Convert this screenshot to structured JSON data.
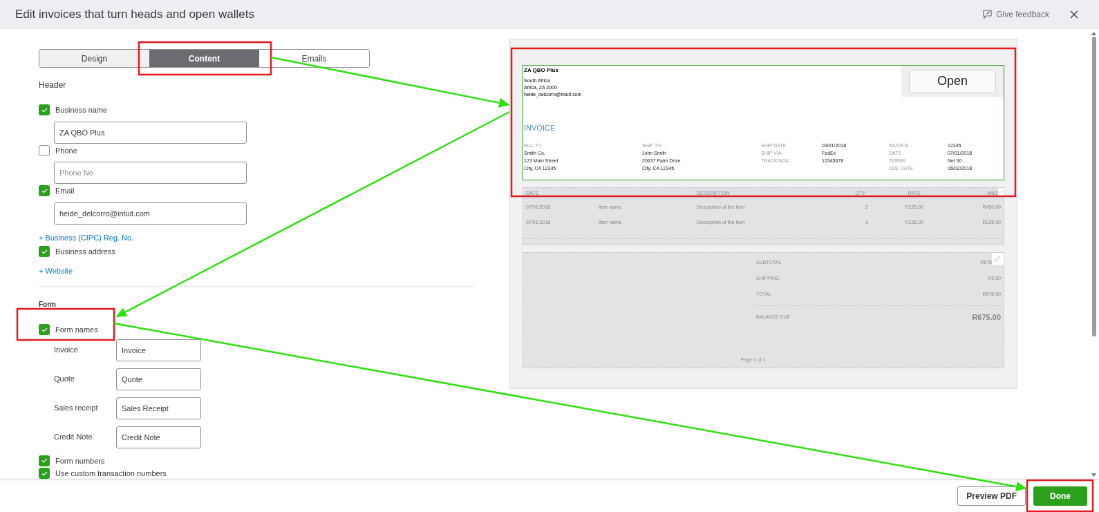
{
  "dialog": {
    "title": "Edit invoices that turn heads and open wallets",
    "feedback": "Give feedback"
  },
  "tabs": [
    {
      "label": "Design",
      "selected": false
    },
    {
      "label": "Content",
      "selected": true
    },
    {
      "label": "Emails",
      "selected": false
    }
  ],
  "header": {
    "title": "Header",
    "items": [
      {
        "kind": "check",
        "label": "Business name",
        "checked": true,
        "field": {
          "value": "ZA QBO Plus"
        }
      },
      {
        "kind": "check",
        "label": "Phone",
        "checked": false,
        "field": {
          "placeholder": "Phone No"
        }
      },
      {
        "kind": "check",
        "label": "Email",
        "checked": true,
        "field": {
          "value": "heide_delcorro@intuit.com"
        }
      },
      {
        "kind": "link",
        "label": "+ Business (CIPC) Reg. No."
      },
      {
        "kind": "check",
        "label": "Business address",
        "checked": true
      },
      {
        "kind": "link",
        "label": "+ Website"
      }
    ]
  },
  "form": {
    "title": "Form",
    "form_names": {
      "label": "Form names",
      "checked": true
    },
    "names": [
      {
        "label": "Invoice",
        "value": "Invoice"
      },
      {
        "label": "Quote",
        "value": "Quote"
      },
      {
        "label": "Sales receipt",
        "value": "Sales Receipt"
      },
      {
        "label": "Credit Note",
        "value": "Credit Note"
      }
    ],
    "more": [
      {
        "label": "Form numbers",
        "checked": true
      },
      {
        "label": "Use custom transaction numbers",
        "checked": true
      }
    ]
  },
  "preview": {
    "company": {
      "name": "ZA QBO Plus",
      "lines": [
        "South Africa",
        "Africa, ZA 2000",
        "heide_delcorro@intuit.com"
      ]
    },
    "open_button": "Open",
    "doc_title": "INVOICE",
    "bill_to": {
      "label": "BILL TO",
      "lines": [
        "Smith Co.",
        "123 Main Street",
        "City, CA 12345"
      ]
    },
    "ship_to": {
      "label": "SHIP TO",
      "lines": [
        "John Smith",
        "20637 Palm Drive",
        "City, CA 12345"
      ]
    },
    "ship_fields": [
      {
        "label": "SHIP DATE",
        "value": "03/01/2018"
      },
      {
        "label": "SHIP VIA",
        "value": "FedEx"
      },
      {
        "label": "TRACKING#",
        "value": "12345678"
      }
    ],
    "invoice_fields": [
      {
        "label": "INVOICE",
        "value": "12345"
      },
      {
        "label": "DATE",
        "value": "07/01/2018"
      },
      {
        "label": "TERMS",
        "value": "Net 30"
      },
      {
        "label": "DUE DATE",
        "value": "06/02/2018"
      }
    ],
    "columns": [
      "DATE",
      "",
      "DESCRIPTION",
      "QTY",
      "RATE",
      "AMO"
    ],
    "rows": [
      [
        "07/01/2018",
        "Item name",
        "Description of the item",
        "2",
        "R225.00",
        "R450.00"
      ],
      [
        "07/01/2018",
        "Item name",
        "Description of the item",
        "1",
        "R225.00",
        "R225.00"
      ]
    ],
    "totals": [
      {
        "label": "SUBTOTAL",
        "value": "R675"
      },
      {
        "label": "SHIPPING",
        "value": "R3.50"
      },
      {
        "label": "TOTAL",
        "value": "R678.50"
      }
    ],
    "balance": {
      "label": "BALANCE DUE",
      "value": "R675.00"
    },
    "page": "Page 1 of 1"
  },
  "footer": {
    "buttons": [
      {
        "label": "Preview PDF",
        "kind": "secondary"
      },
      {
        "label": "Done",
        "kind": "primary"
      }
    ]
  }
}
